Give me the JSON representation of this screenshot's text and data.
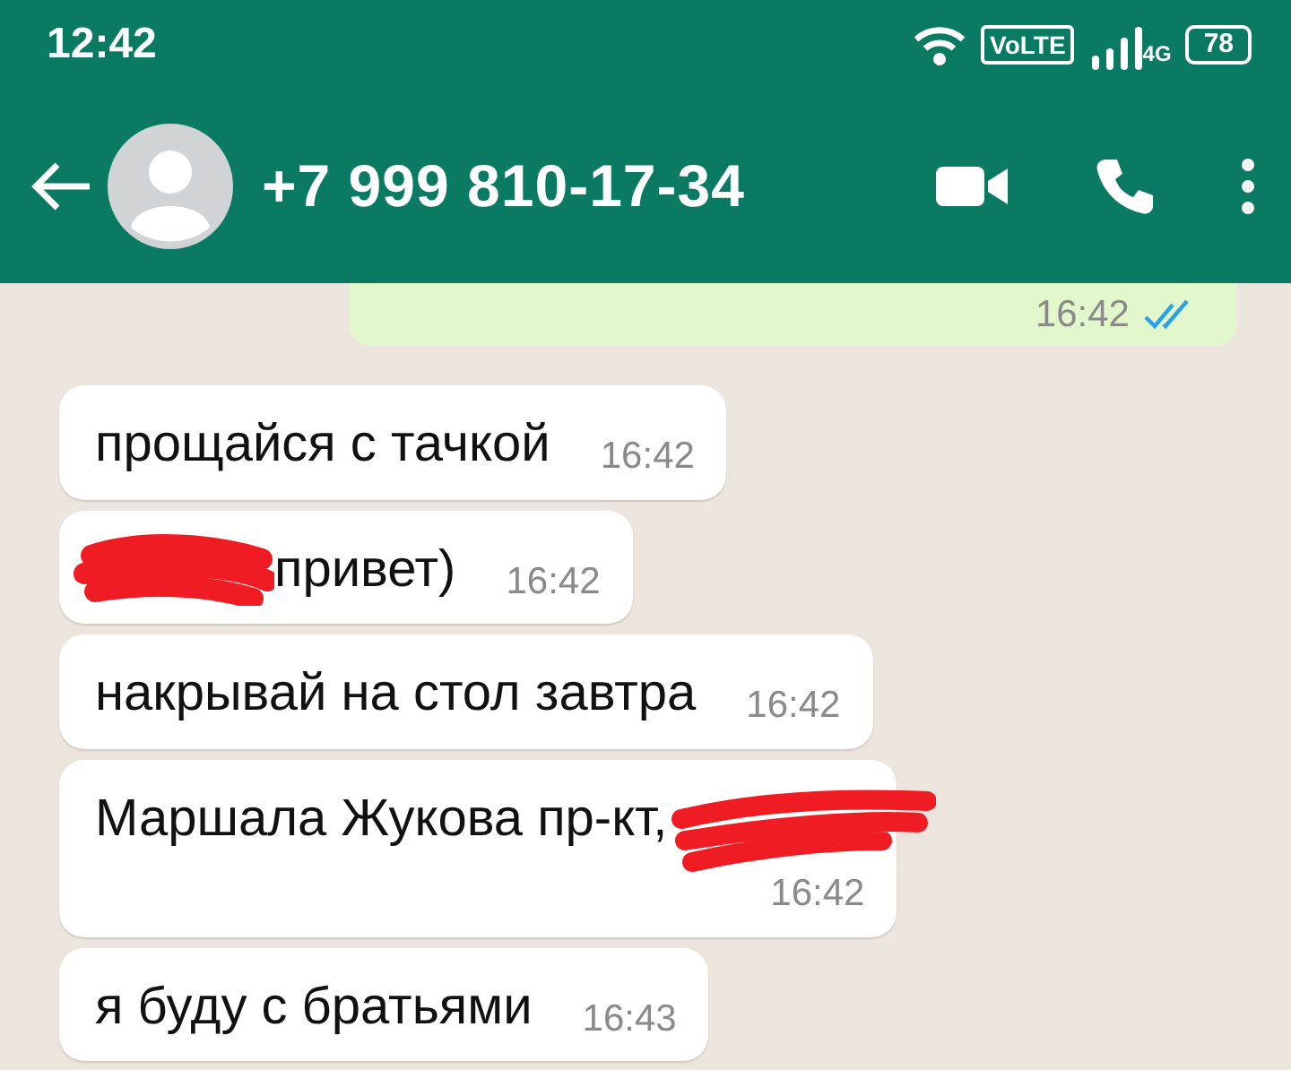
{
  "status_bar": {
    "time": "12:42",
    "volte": "VoLTE",
    "network": "4G",
    "battery": "78"
  },
  "header": {
    "contact": "+7 999 810-17-34"
  },
  "partial_outgoing": {
    "time": "16:42",
    "read": true
  },
  "messages": [
    {
      "text": "прощайся с тачкой",
      "time": "16:42",
      "kind": "inline",
      "redacted_start": false,
      "redacted_end": false
    },
    {
      "text": "привет)",
      "time": "16:42",
      "kind": "inline",
      "redacted_start": true,
      "redacted_end": false
    },
    {
      "text": "накрывай на стол завтра",
      "time": "16:42",
      "kind": "inline",
      "redacted_start": false,
      "redacted_end": false
    },
    {
      "text": "Маршала Жукова пр-кт,",
      "time": "16:42",
      "kind": "stacked",
      "redacted_start": false,
      "redacted_end": true
    },
    {
      "text": "я буду с братьями",
      "time": "16:43",
      "kind": "inline",
      "redacted_start": false,
      "redacted_end": false
    }
  ]
}
